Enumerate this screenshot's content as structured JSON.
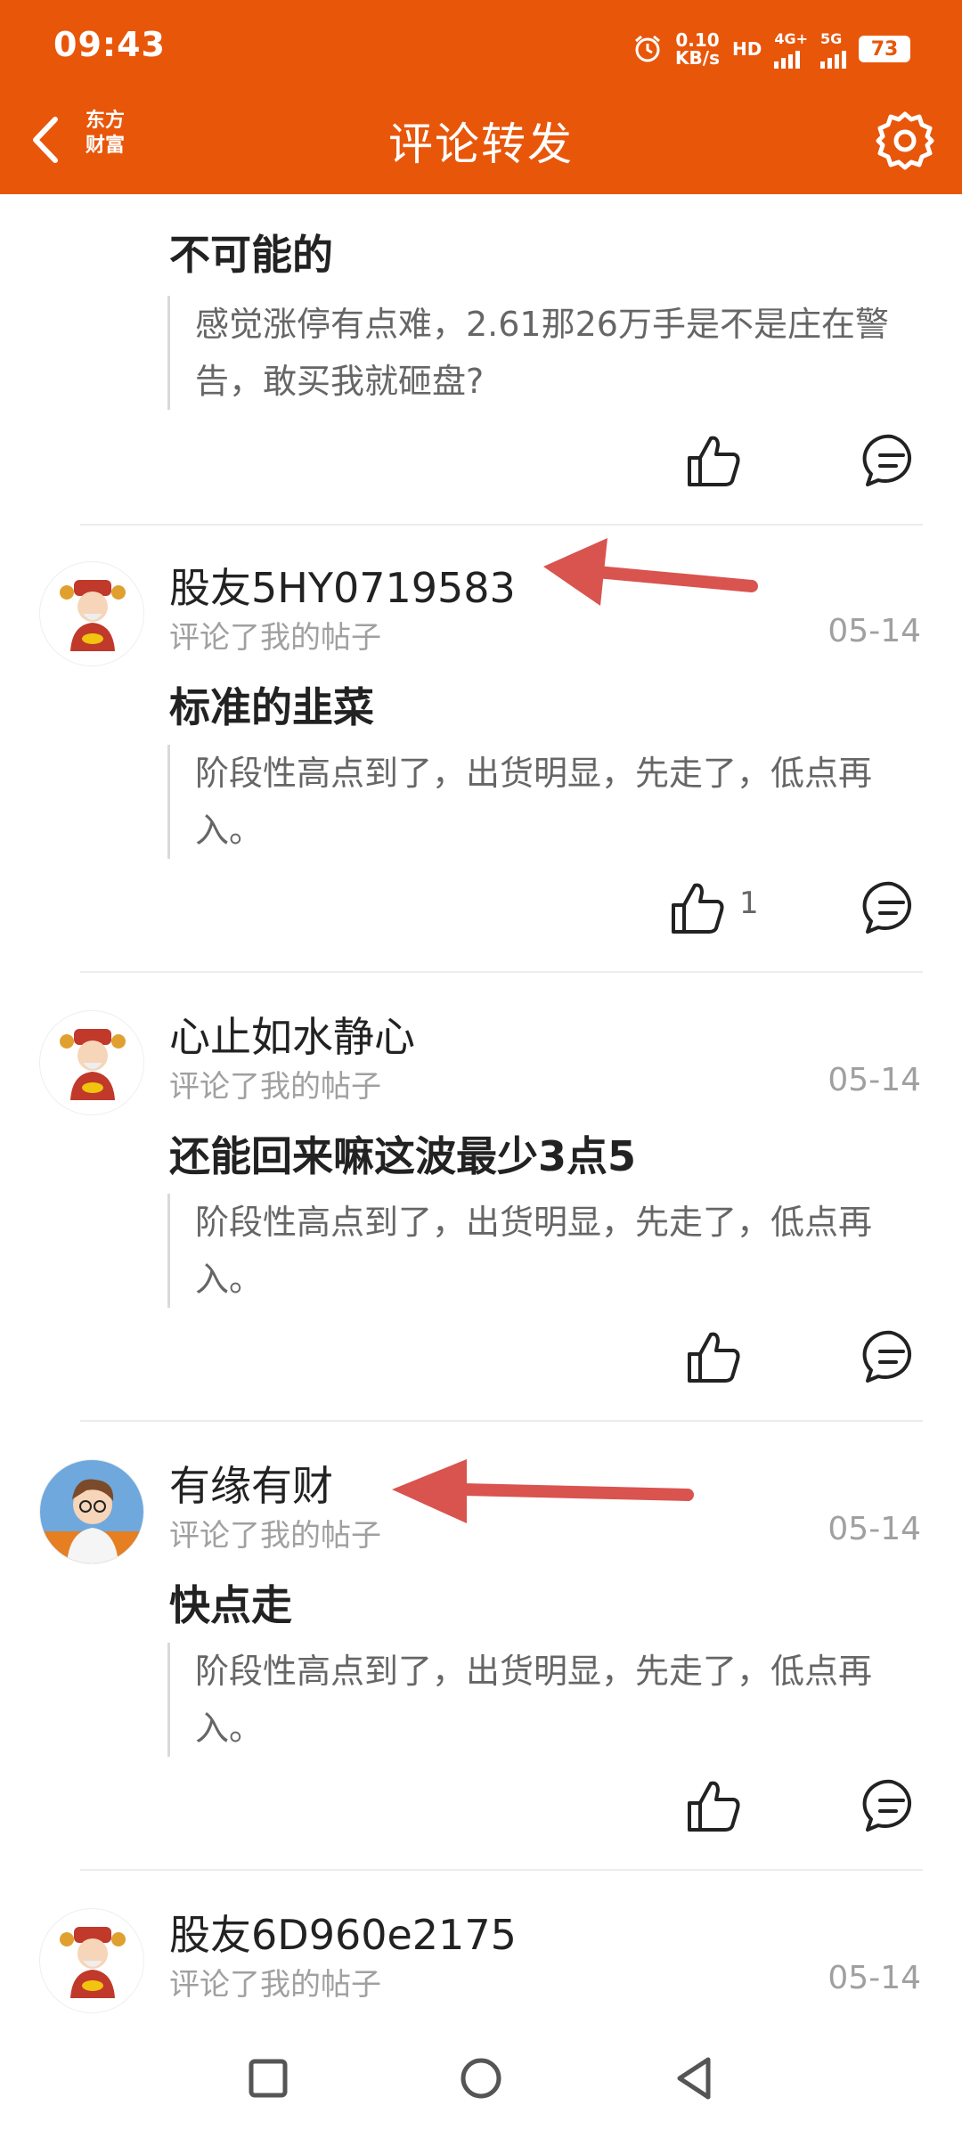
{
  "status_bar": {
    "time": "09:43",
    "speed_value": "0.10",
    "speed_unit": "KB/s",
    "hd": "HD",
    "network_4g": "4G+",
    "network_5g": "5G",
    "battery": "73"
  },
  "header": {
    "back_icon": "chevron-left-icon",
    "logo_line1": "东方",
    "logo_line2": "财富",
    "title": "评论转发",
    "settings_icon": "gear-icon"
  },
  "items": [
    {
      "comment": "不可能的",
      "quote": "感觉涨停有点难，2.61那26万手是不是庄在警告，敢买我就砸盘?",
      "like_count": ""
    },
    {
      "username": "股友5HY0719583",
      "subtitle": "评论了我的帖子",
      "date": "05-14",
      "comment": "标准的韭菜",
      "quote": "阶段性高点到了，出货明显，先走了，低点再入。",
      "like_count": "1"
    },
    {
      "username": "心止如水静心",
      "subtitle": "评论了我的帖子",
      "date": "05-14",
      "comment": "还能回来嘛这波最少3点5",
      "quote": "阶段性高点到了，出货明显，先走了，低点再入。",
      "like_count": ""
    },
    {
      "username": "有缘有财",
      "subtitle": "评论了我的帖子",
      "date": "05-14",
      "comment": "快点走",
      "quote": "阶段性高点到了，出货明显，先走了，低点再入。",
      "like_count": ""
    },
    {
      "username": "股友6D960e2175",
      "subtitle": "评论了我的帖子",
      "date": "05-14"
    }
  ],
  "colors": {
    "brand": "#E8560A",
    "annotation_arrow": "#D9534F"
  }
}
